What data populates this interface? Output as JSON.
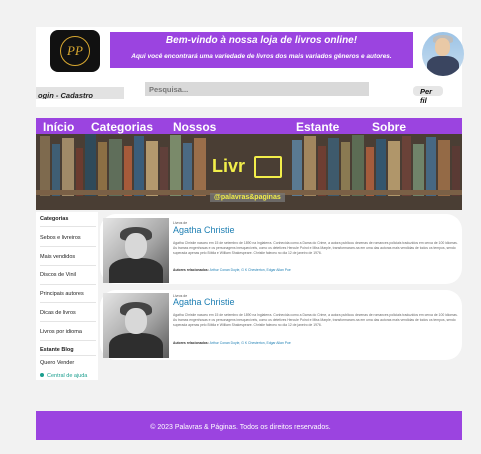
{
  "header": {
    "logo_initials": "PP",
    "banner_title": "Bem-vindo à nossa loja de livros online!",
    "banner_subtitle": "Aqui você encontrará uma variedade de livros dos mais variados gêneros e autores.",
    "login_label": "ogin - Cadastro",
    "search_placeholder": "Pesquisa...",
    "profile_label": "Per fil"
  },
  "nav": {
    "items": [
      "Início",
      "Categorias",
      "Nossos Autores",
      "Estante",
      "Sobre Nós"
    ]
  },
  "hero": {
    "logo_text": "Livr",
    "handle": "@palavras&paginas"
  },
  "sidebar": {
    "categories_title": "Categorias",
    "categories": [
      "Sebos e livreiros",
      "Mais vendidos",
      "Discos de Vinil",
      "Principais autores",
      "Dicas de livros",
      "Livros por idioma"
    ],
    "blog_title": "Estante Blog",
    "blog_items": [
      "Quero Vender"
    ],
    "help_label": "Central de ajuda"
  },
  "cards": [
    {
      "small_label": "Livros de",
      "title": "Agatha Christie",
      "bio": "Agatha Christie nasceu em 15 de setembro de 1890 na Inglaterra. Conhecida como a Dama do Crime, a autora publicou dezenas de romances policiais traduzidos em cerca de 100 idiomas. As tramas engenhosas e os personagens inesquecíveis, como os detetives Hercule Poirot e Miss Marple, transformaram-na em uma das autoras mais vendidas de todos os tempos, sendo superada apenas pelo Bíblia e William Shakespeare. Christie faleceu no dia 12 de janeiro de 1976.",
      "related_label": "Autores relacionados:",
      "related_links": "Arthur Conan Doyle, G K Chesterton, Edgar Allan Poe"
    },
    {
      "small_label": "Livros de",
      "title": "Agatha Christie",
      "bio": "Agatha Christie nasceu em 15 de setembro de 1890 na Inglaterra. Conhecida como a Dama do Crime, a autora publicou dezenas de romances policiais traduzidos em cerca de 100 idiomas. As tramas engenhosas e os personagens inesquecíveis, como os detetives Hercule Poirot e Miss Marple, transformaram-na em uma das autoras mais vendidas de todos os tempos, sendo superada apenas pelo Bíblia e William Shakespeare. Christie faleceu no dia 12 de janeiro de 1976.",
      "related_label": "Autores relacionados:",
      "related_links": "Arthur Conan Doyle, G K Chesterton, Edgar Allan Poe"
    }
  ],
  "footer": {
    "text": "© 2023 Palavras & Páginas. Todos os direitos reservados."
  },
  "colors": {
    "accent": "#9b44e0",
    "link": "#1e7fb3",
    "help": "#1a9e8e"
  },
  "icons": [
    "logo-emblem",
    "help-dot-icon",
    "book-icon"
  ]
}
